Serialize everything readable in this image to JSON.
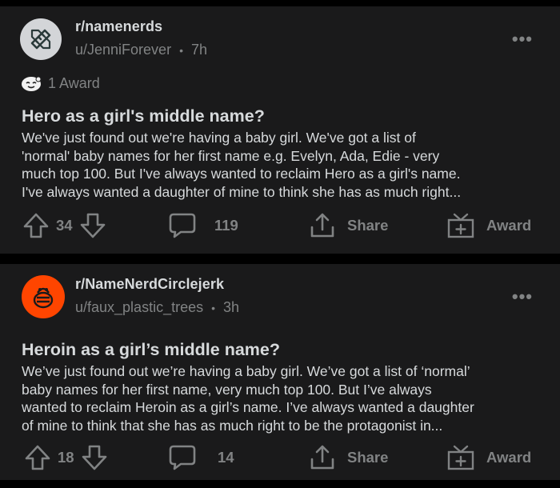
{
  "posts": [
    {
      "subreddit": "r/namenerds",
      "user": "u/JenniForever",
      "separator": "•",
      "time": "7h",
      "award_text": "1 Award",
      "title": "Hero as a girl's middle name?",
      "body_lines": [
        "We've just found out we're having a baby girl. We've got a list of",
        "'normal' baby names for her first name e.g. Evelyn, Ada, Edie - very",
        "much top 100. But I've always wanted to reclaim Hero as a girl's name.",
        "I've always wanted a daughter of mine to think she has as much right..."
      ],
      "votes": "34",
      "comments": "119",
      "share_label": "Share",
      "award_label": "Award",
      "avatar_icon": "pencil-ruler-icon",
      "avatar_color": "#d3d5d8"
    },
    {
      "subreddit": "r/NameNerdCirclejerk",
      "user": "u/faux_plastic_trees",
      "separator": "•",
      "time": "3h",
      "title": "Heroin as a girl’s middle name?",
      "body_lines": [
        "We’ve just found out we’re having a baby girl. We’ve got a list of ‘normal’",
        "baby names for her first name, very much top 100. But I’ve always",
        "wanted to reclaim Heroin as a girl’s name. I’ve always wanted a daughter",
        "of mine to think that she has as much right to be the protagonist in..."
      ],
      "votes": "18",
      "comments": "14",
      "share_label": "Share",
      "award_label": "Award",
      "avatar_icon": "snoo-icon",
      "avatar_color": "#ff4500"
    }
  ],
  "colors": {
    "card_bg": "#1a1a1b",
    "text": "#d7dadc",
    "muted": "#818384",
    "page_bg": "#000000"
  }
}
